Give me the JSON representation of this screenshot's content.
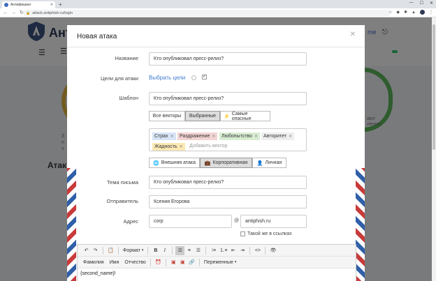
{
  "browser": {
    "tab_title": "Антифишинг",
    "url": "attack.antiphish.ru/login"
  },
  "page": {
    "brand": "Ант",
    "top_link": "me",
    "side_text_left": "З\nн\nз",
    "side_text_right": "ают\nления",
    "section_title": "Атак"
  },
  "modal": {
    "title": "Новая атака",
    "fields": {
      "name_label": "Название",
      "name_value": "Кто опубликовал пресс-релиз?",
      "targets_label": "Цели для атаки",
      "targets_link": "Выбрать цели",
      "template_label": "Шаблон",
      "template_value": "Кто опубликовал пресс-релиз?",
      "subject_label": "Тема письма",
      "subject_value": "Кто опубликовал пресс-релиз?",
      "sender_label": "Отправитель",
      "sender_value": "Ксения Егорова",
      "address_label": "Адрес",
      "address_local": "corp",
      "address_at": "@",
      "address_domain": "antiphish.ru",
      "same_in_links": "Такой же в ссылках"
    },
    "vector_filters": [
      "Все векторы",
      "Выбранные",
      "Самые опасные"
    ],
    "vector_filter_selected": "Выбранные",
    "tags": [
      {
        "label": "Страх",
        "color": "#d6e4f5"
      },
      {
        "label": "Раздражение",
        "color": "#f3d3d3"
      },
      {
        "label": "Любопытство",
        "color": "#d8ecd2"
      },
      {
        "label": "Авторитет",
        "color": "#eeeeee"
      },
      {
        "label": "Жадность",
        "color": "#fbe8b4"
      }
    ],
    "tag_placeholder": "Добавить вектор",
    "attack_types": [
      "Внешняя атака",
      "Корпоративная",
      "Личная"
    ],
    "attack_type_selected": "Корпоративная",
    "editor": {
      "format_label": "Формат",
      "variables_label": "Переменные",
      "var_buttons": [
        "Фамилия",
        "Имя",
        "Отчество"
      ],
      "body_text": "{second_name}!"
    }
  }
}
